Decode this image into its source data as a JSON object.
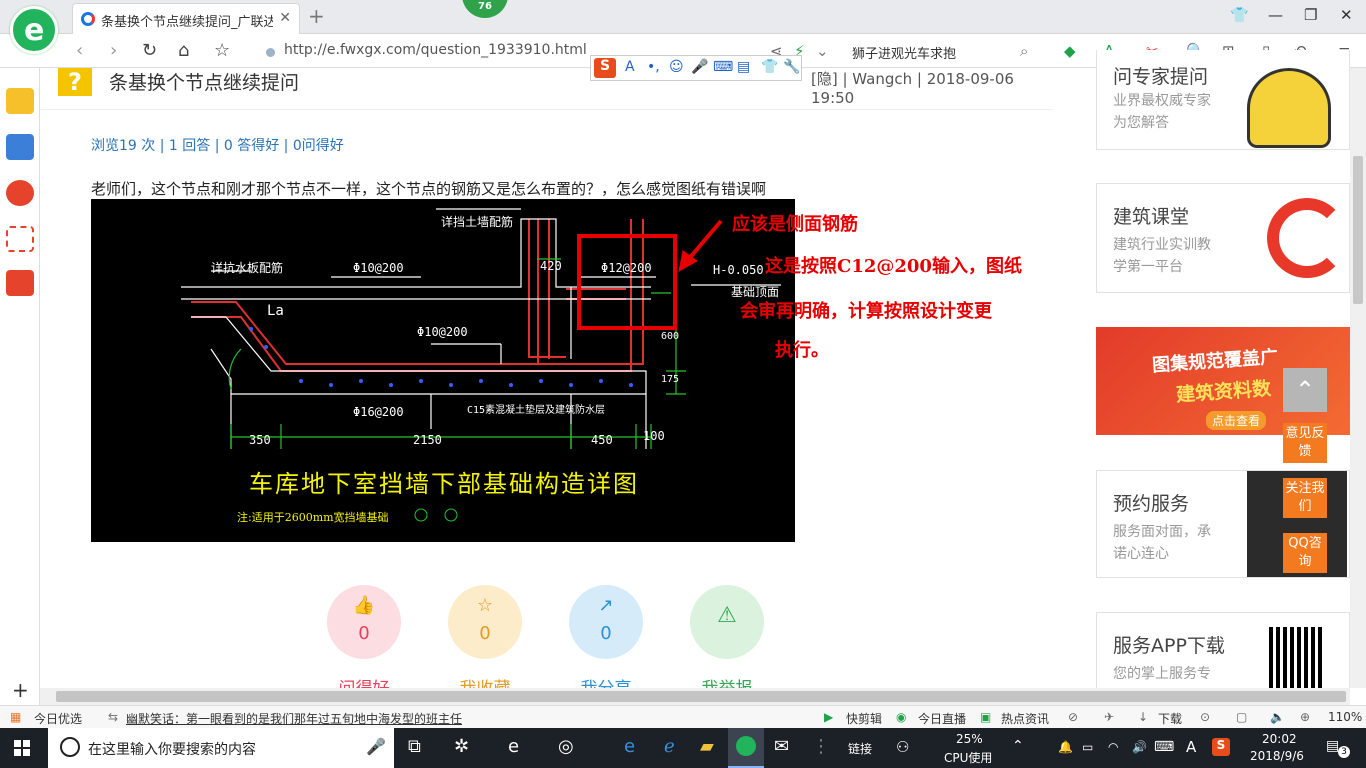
{
  "browser": {
    "tab_title": "条基换个节点继续提问_广联达服",
    "badge": "76",
    "url": "http://e.fwxgx.com/question_1933910.html",
    "search_text": "狮子进观光车求抱"
  },
  "question": {
    "title": "条基换个节点继续提问",
    "meta": "[隐] | Wangch | 2018-09-06 19:50",
    "stats": "浏览19 次 | 1 回答 | 0 答得好 | 0问得好",
    "text": "老师们，这个节点和刚才那个节点不一样，这个节点的钢筋又是怎么布置的？，怎么感觉图纸有错误啊"
  },
  "drawing": {
    "title": "车库地下室挡墙下部基础构造详图",
    "note": "注:适用于2600mm宽挡墙基础",
    "labels": {
      "l1": "详挡土墙配筋",
      "l2": "详抗水板配筋",
      "l3": "Φ10@200",
      "l4": "Φ12@200",
      "l5": "H-0.050",
      "l6": "基础顶面",
      "l7": "La",
      "l8": "Φ10@200",
      "l9": "Φ16@200",
      "l10": "C15素混凝土垫层及建筑防水层",
      "l11": "350",
      "l12": "2150",
      "l13": "450",
      "l14": "100",
      "l15": "420",
      "l16": "175",
      "l17": "600"
    }
  },
  "annotations": {
    "a1": "应该是侧面钢筋",
    "a2": "这是按照C12@200输入，图纸",
    "a3": "会审再明确，计算按照设计变更",
    "a4": "执行。"
  },
  "actions": [
    {
      "label": "问得好",
      "count": "0",
      "color": "#e8425b"
    },
    {
      "label": "我收藏",
      "count": "0",
      "color": "#e39a20"
    },
    {
      "label": "我分享",
      "count": "0",
      "color": "#2d8fd6"
    },
    {
      "label": "我举报",
      "count": "",
      "color": "#33a853"
    }
  ],
  "sidebar": {
    "card1": {
      "title": "问专家提问",
      "desc1": "业界最权威专家",
      "desc2": "为您解答"
    },
    "card2": {
      "title": "建筑课堂",
      "desc1": "建筑行业实训教",
      "desc2": "学第一平台"
    },
    "banner": {
      "line1": "图集规范覆盖广",
      "line2": "建筑资料数",
      "btn": "点击查看"
    },
    "card3": {
      "title": "预约服务",
      "desc1": "服务面对面，承",
      "desc2": "诺心连心"
    },
    "card4": {
      "title": "服务APP下载",
      "desc1": "您的掌上服务专"
    },
    "float_feedback": "意见反馈",
    "float_follow": "关注我们",
    "float_qq": "QQ咨询"
  },
  "statusbar": {
    "today": "今日优选",
    "news": "幽默笑话：第一眼看到的是我们那年过五旬地中海发型的班主任",
    "s1": "快剪辑",
    "s2": "今日直播",
    "s3": "热点资讯",
    "s4": "下载",
    "zoom": "110%"
  },
  "taskbar": {
    "search_placeholder": "在这里输入你要搜索的内容",
    "link": "链接",
    "cpu_pct": "25%",
    "cpu_label": "CPU使用",
    "ime": "A",
    "time": "20:02",
    "date": "2018/9/6",
    "notif": "3"
  }
}
